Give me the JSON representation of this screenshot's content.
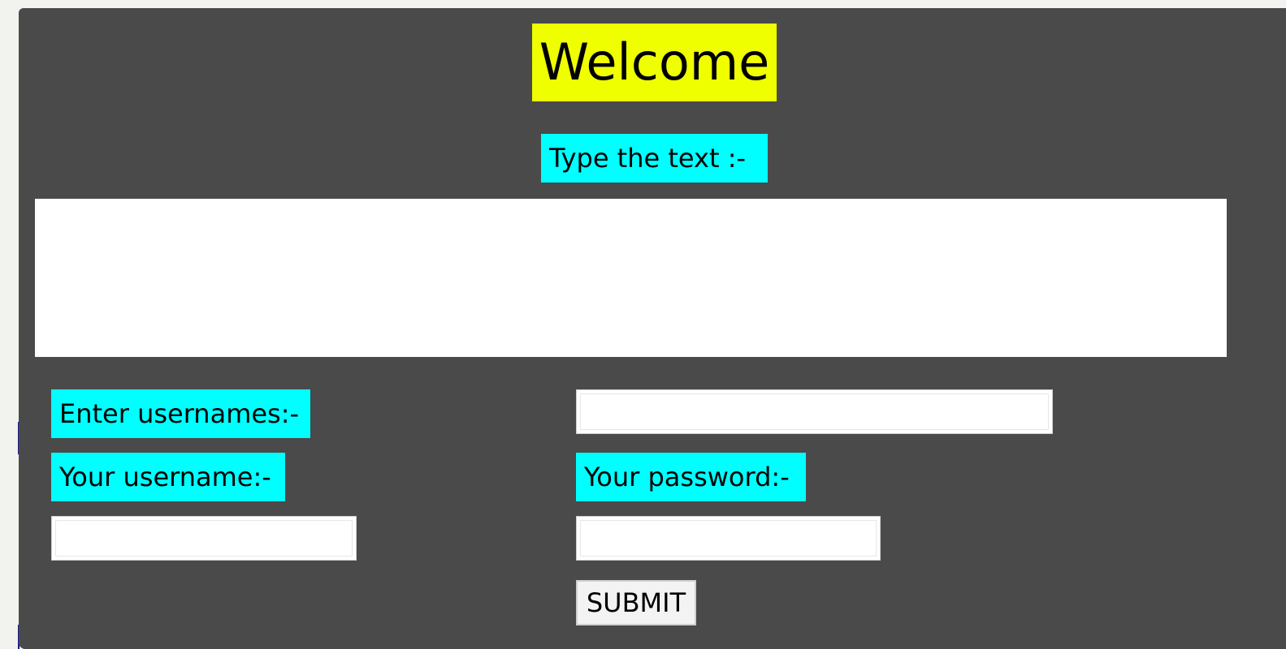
{
  "page": {
    "background_color": "#4a4a4a",
    "outer_color": "#f2f2ee"
  },
  "header": {
    "title": "Welcome",
    "title_bg_color": "#f0ff00"
  },
  "text_section": {
    "label": "Type the text :-",
    "label_bg_color": "#00ffff",
    "textarea_value": ""
  },
  "form": {
    "usernames_label": "Enter usernames:-",
    "usernames_value": "",
    "username_label": "Your username:-",
    "username_value": "",
    "password_label": "Your password:-",
    "password_value": "",
    "submit_label": "SUBMIT"
  }
}
